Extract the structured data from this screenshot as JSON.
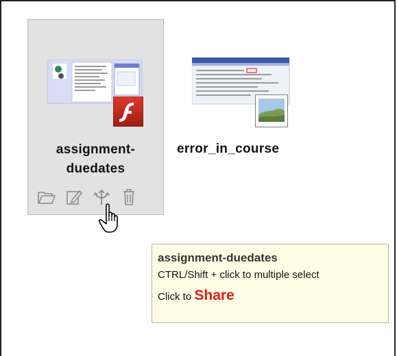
{
  "files": [
    {
      "name_line1": "assignment-",
      "name_line2": "duedates",
      "type_icon": "flash-icon",
      "selected": true
    },
    {
      "name_line1": "error_in_course",
      "type_icon": "image-icon",
      "selected": false
    }
  ],
  "actions": [
    {
      "icon": "folder-open-icon"
    },
    {
      "icon": "edit-icon"
    },
    {
      "icon": "share-icon"
    },
    {
      "icon": "trash-icon"
    }
  ],
  "tooltip": {
    "title": "assignment-duedates",
    "hint": "CTRL/Shift + click to multiple select",
    "share_prefix": "Click to",
    "share_action": "Share"
  },
  "colors": {
    "selected_bg": "#e2e2e2",
    "tooltip_bg": "#fefee6",
    "share_accent": "#d91d1d",
    "flash_badge": "#c0271d"
  }
}
